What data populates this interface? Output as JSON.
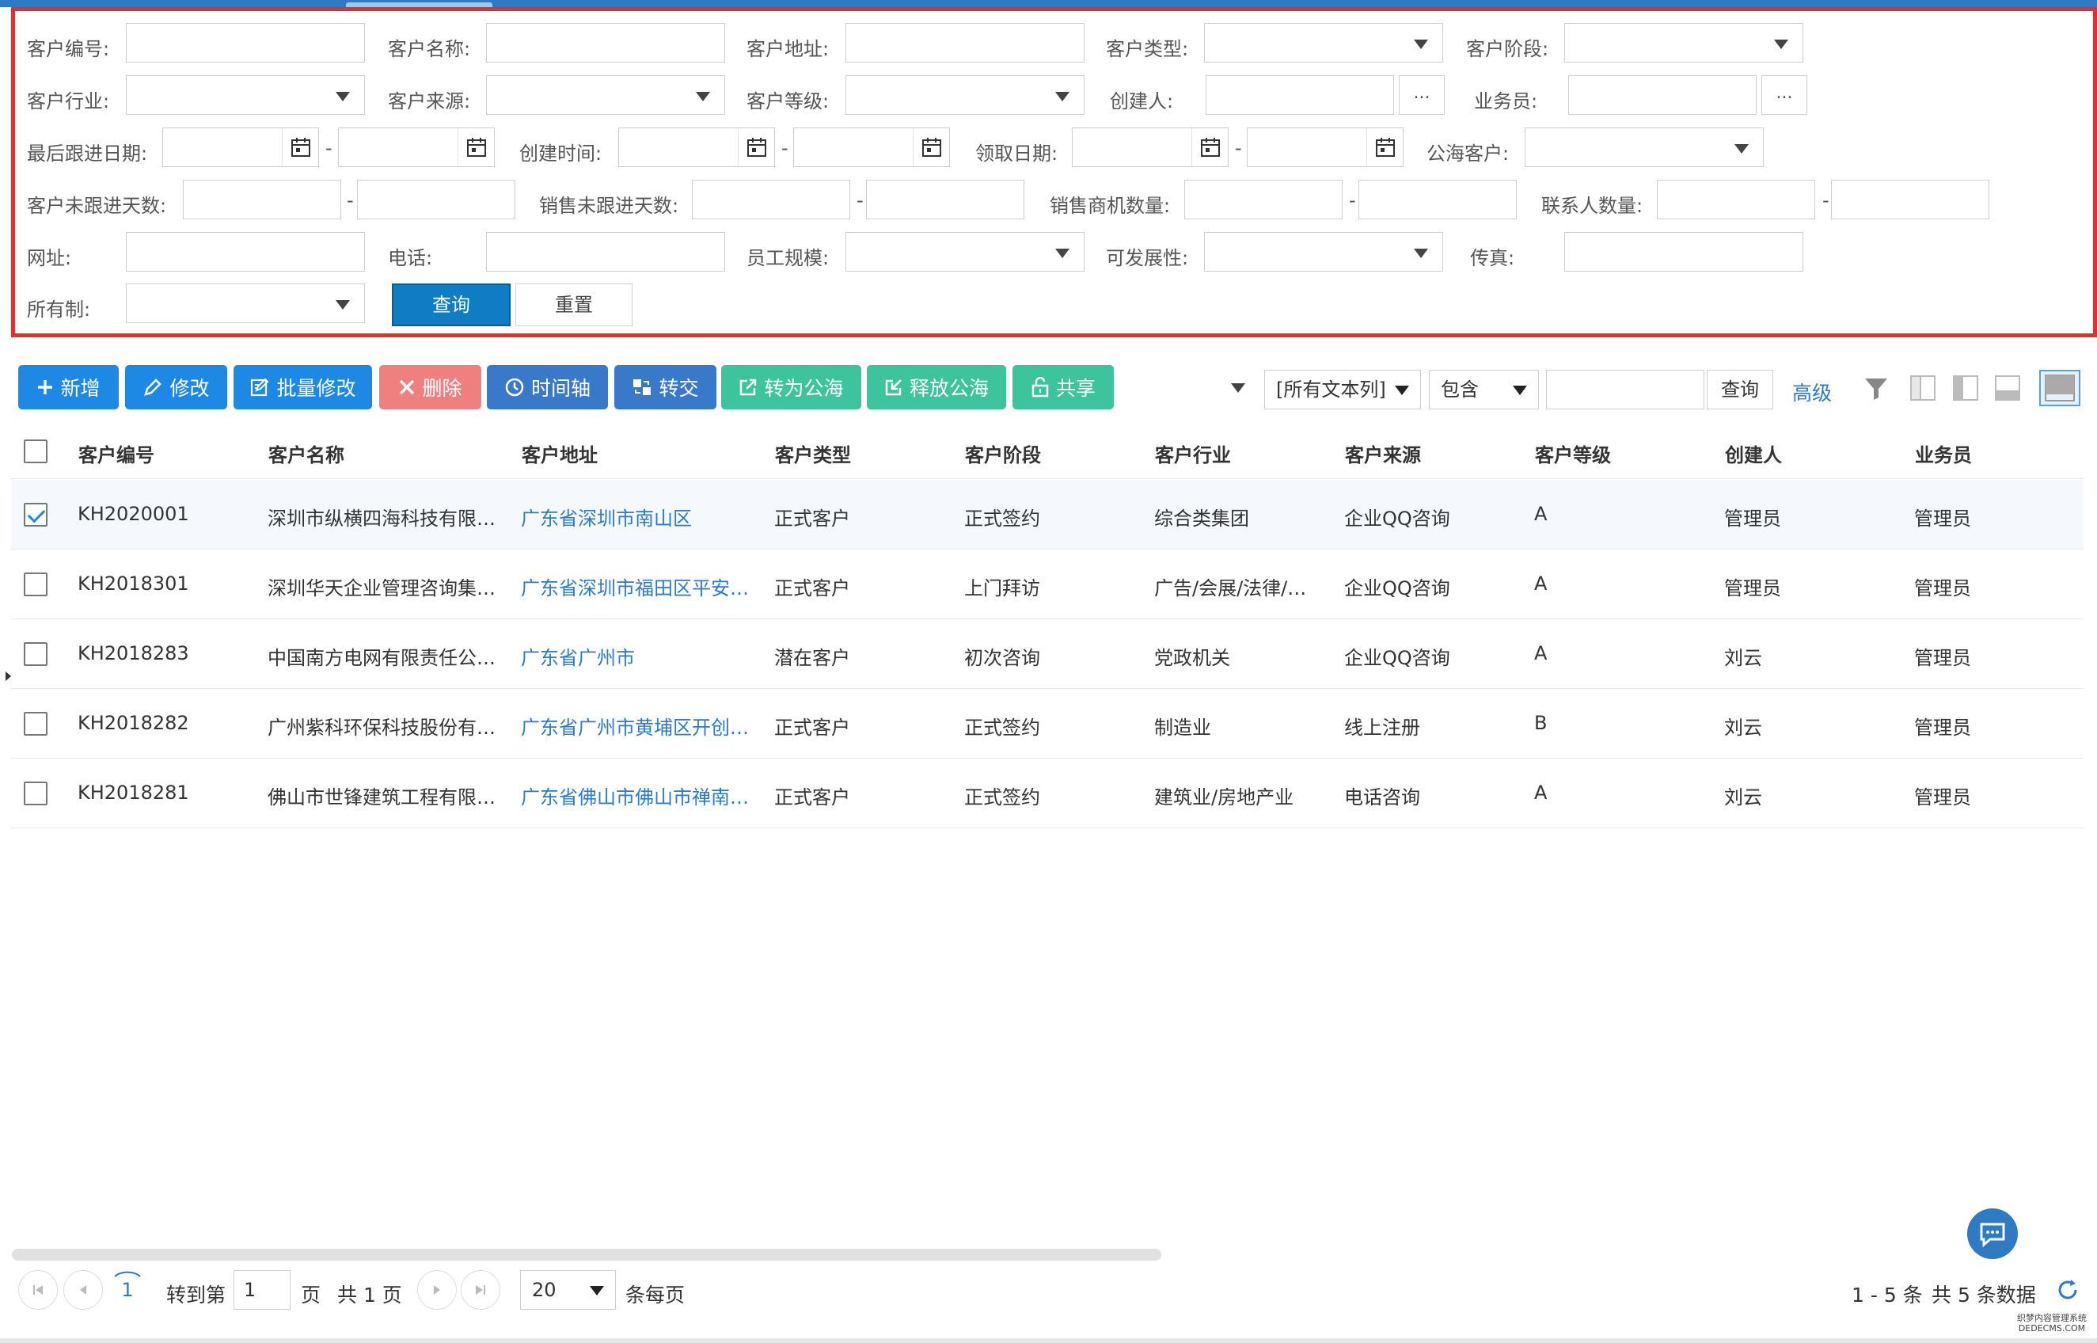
{
  "filters": {
    "row1": {
      "customer_no": "客户编号:",
      "customer_name": "客户名称:",
      "customer_address": "客户地址:",
      "customer_type": "客户类型:",
      "customer_stage": "客户阶段:"
    },
    "row2": {
      "industry": "客户行业:",
      "source": "客户来源:",
      "level": "客户等级:",
      "creator": "创建人:",
      "salesman": "业务员:",
      "dots": "..."
    },
    "row3": {
      "last_follow": "最后跟进日期:",
      "created_time": "创建时间:",
      "claim_date": "领取日期:",
      "public_customer": "公海客户:",
      "dash": "-"
    },
    "row4": {
      "customer_days": "客户未跟进天数:",
      "sales_days": "销售未跟进天数:",
      "opportunity_count": "销售商机数量:",
      "contact_count": "联系人数量:",
      "dash": "-"
    },
    "row5": {
      "website": "网址:",
      "phone": "电话:",
      "staff_size": "员工规模:",
      "potential": "可发展性:",
      "fax": "传真:"
    },
    "row6": {
      "ownership": "所有制:",
      "query": "查询",
      "reset": "重置"
    }
  },
  "toolbar": {
    "add": "新增",
    "edit": "修改",
    "batch_edit": "批量修改",
    "delete": "删除",
    "timeline": "时间轴",
    "transfer": "转交",
    "to_public": "转为公海",
    "release": "释放公海",
    "share": "共享"
  },
  "search": {
    "column": "[所有文本列]",
    "operator": "包含",
    "value": "",
    "query": "查询",
    "advanced": "高级"
  },
  "grid": {
    "headers": [
      "客户编号",
      "客户名称",
      "客户地址",
      "客户类型",
      "客户阶段",
      "客户行业",
      "客户来源",
      "客户等级",
      "创建人",
      "业务员"
    ],
    "rows": [
      {
        "checked": true,
        "cells": [
          "KH2020001",
          "深圳市纵横四海科技有限…",
          "广东省深圳市南山区",
          "正式客户",
          "正式签约",
          "综合类集团",
          "企业QQ咨询",
          "A",
          "管理员",
          "管理员"
        ]
      },
      {
        "checked": false,
        "cells": [
          "KH2018301",
          "深圳华天企业管理咨询集…",
          "广东省深圳市福田区平安…",
          "正式客户",
          "上门拜访",
          "广告/会展/法律/…",
          "企业QQ咨询",
          "A",
          "管理员",
          "管理员"
        ]
      },
      {
        "checked": false,
        "cells": [
          "KH2018283",
          "中国南方电网有限责任公…",
          "广东省广州市",
          "潜在客户",
          "初次咨询",
          "党政机关",
          "企业QQ咨询",
          "A",
          "刘云",
          "管理员"
        ]
      },
      {
        "checked": false,
        "cells": [
          "KH2018282",
          "广州紫科环保科技股份有…",
          "广东省广州市黄埔区开创…",
          "正式客户",
          "正式签约",
          "制造业",
          "线上注册",
          "B",
          "刘云",
          "管理员"
        ]
      },
      {
        "checked": false,
        "cells": [
          "KH2018281",
          "佛山市世锋建筑工程有限…",
          "广东省佛山市佛山市禅南…",
          "正式客户",
          "正式签约",
          "建筑业/房地产业",
          "电话咨询",
          "A",
          "刘云",
          "管理员"
        ]
      }
    ]
  },
  "pager": {
    "current_page": "1",
    "goto_label": "转到第",
    "goto_value": "1",
    "page_unit": "页",
    "total_pages": "共 1 页",
    "page_size": "20",
    "per_page_label": "条每页",
    "range": "1 - 5 条",
    "total_records": "共 5 条数据"
  },
  "watermark": {
    "line1": "织梦内容管理系统",
    "line2": "DEDECMS.COM"
  },
  "colors": {
    "primary": "#1e88e5",
    "navy_button": "#3a78c9",
    "danger_button": "#f07f7f",
    "success_button": "#3dc49d",
    "query_button": "#0f7cc4",
    "highlight_border": "#e03131",
    "link": "#2e7bc4"
  }
}
